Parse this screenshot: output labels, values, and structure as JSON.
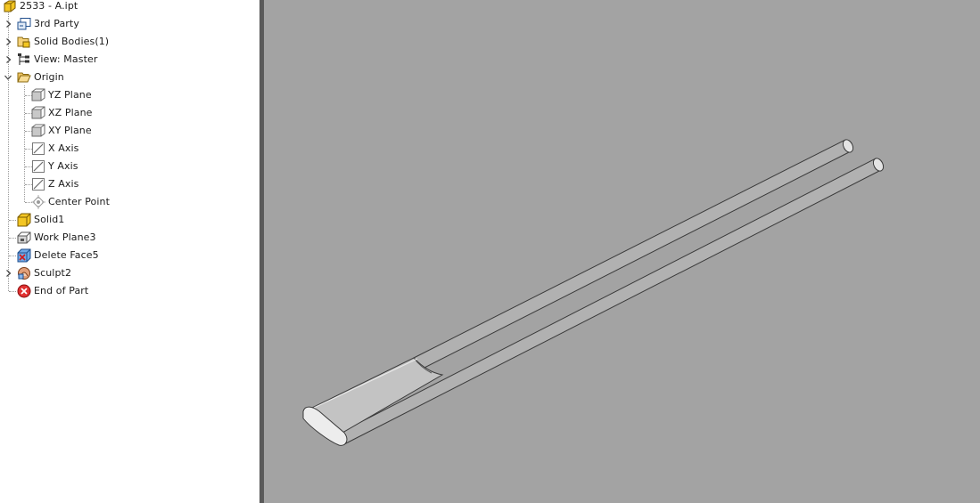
{
  "browser": {
    "root": {
      "label": "2533 - A.ipt",
      "icon": "part-icon"
    },
    "nodes": [
      {
        "label": "3rd Party",
        "icon": "third-party-icon",
        "expander": "collapsed"
      },
      {
        "label": "Solid Bodies(1)",
        "icon": "solid-bodies-icon",
        "expander": "collapsed"
      },
      {
        "label": "View: Master",
        "icon": "view-rep-icon",
        "expander": "collapsed"
      },
      {
        "label": "Origin",
        "icon": "folder-open-icon",
        "expander": "expanded",
        "children": [
          {
            "label": "YZ Plane",
            "icon": "work-plane-icon"
          },
          {
            "label": "XZ Plane",
            "icon": "work-plane-icon"
          },
          {
            "label": "XY Plane",
            "icon": "work-plane-icon"
          },
          {
            "label": "X Axis",
            "icon": "work-axis-icon"
          },
          {
            "label": "Y Axis",
            "icon": "work-axis-icon"
          },
          {
            "label": "Z Axis",
            "icon": "work-axis-icon"
          },
          {
            "label": "Center Point",
            "icon": "work-point-icon"
          }
        ]
      },
      {
        "label": "Solid1",
        "icon": "solid-body-icon",
        "expander": "none"
      },
      {
        "label": "Work Plane3",
        "icon": "work-plane-feature-icon",
        "expander": "none"
      },
      {
        "label": "Delete Face5",
        "icon": "delete-face-icon",
        "expander": "none"
      },
      {
        "label": "Sculpt2",
        "icon": "sculpt-icon",
        "expander": "collapsed"
      },
      {
        "label": "End of Part",
        "icon": "end-of-part-icon",
        "expander": "none"
      }
    ]
  },
  "viewport": {
    "background": "#a3a3a3",
    "model_color": "#cfcfcf"
  }
}
